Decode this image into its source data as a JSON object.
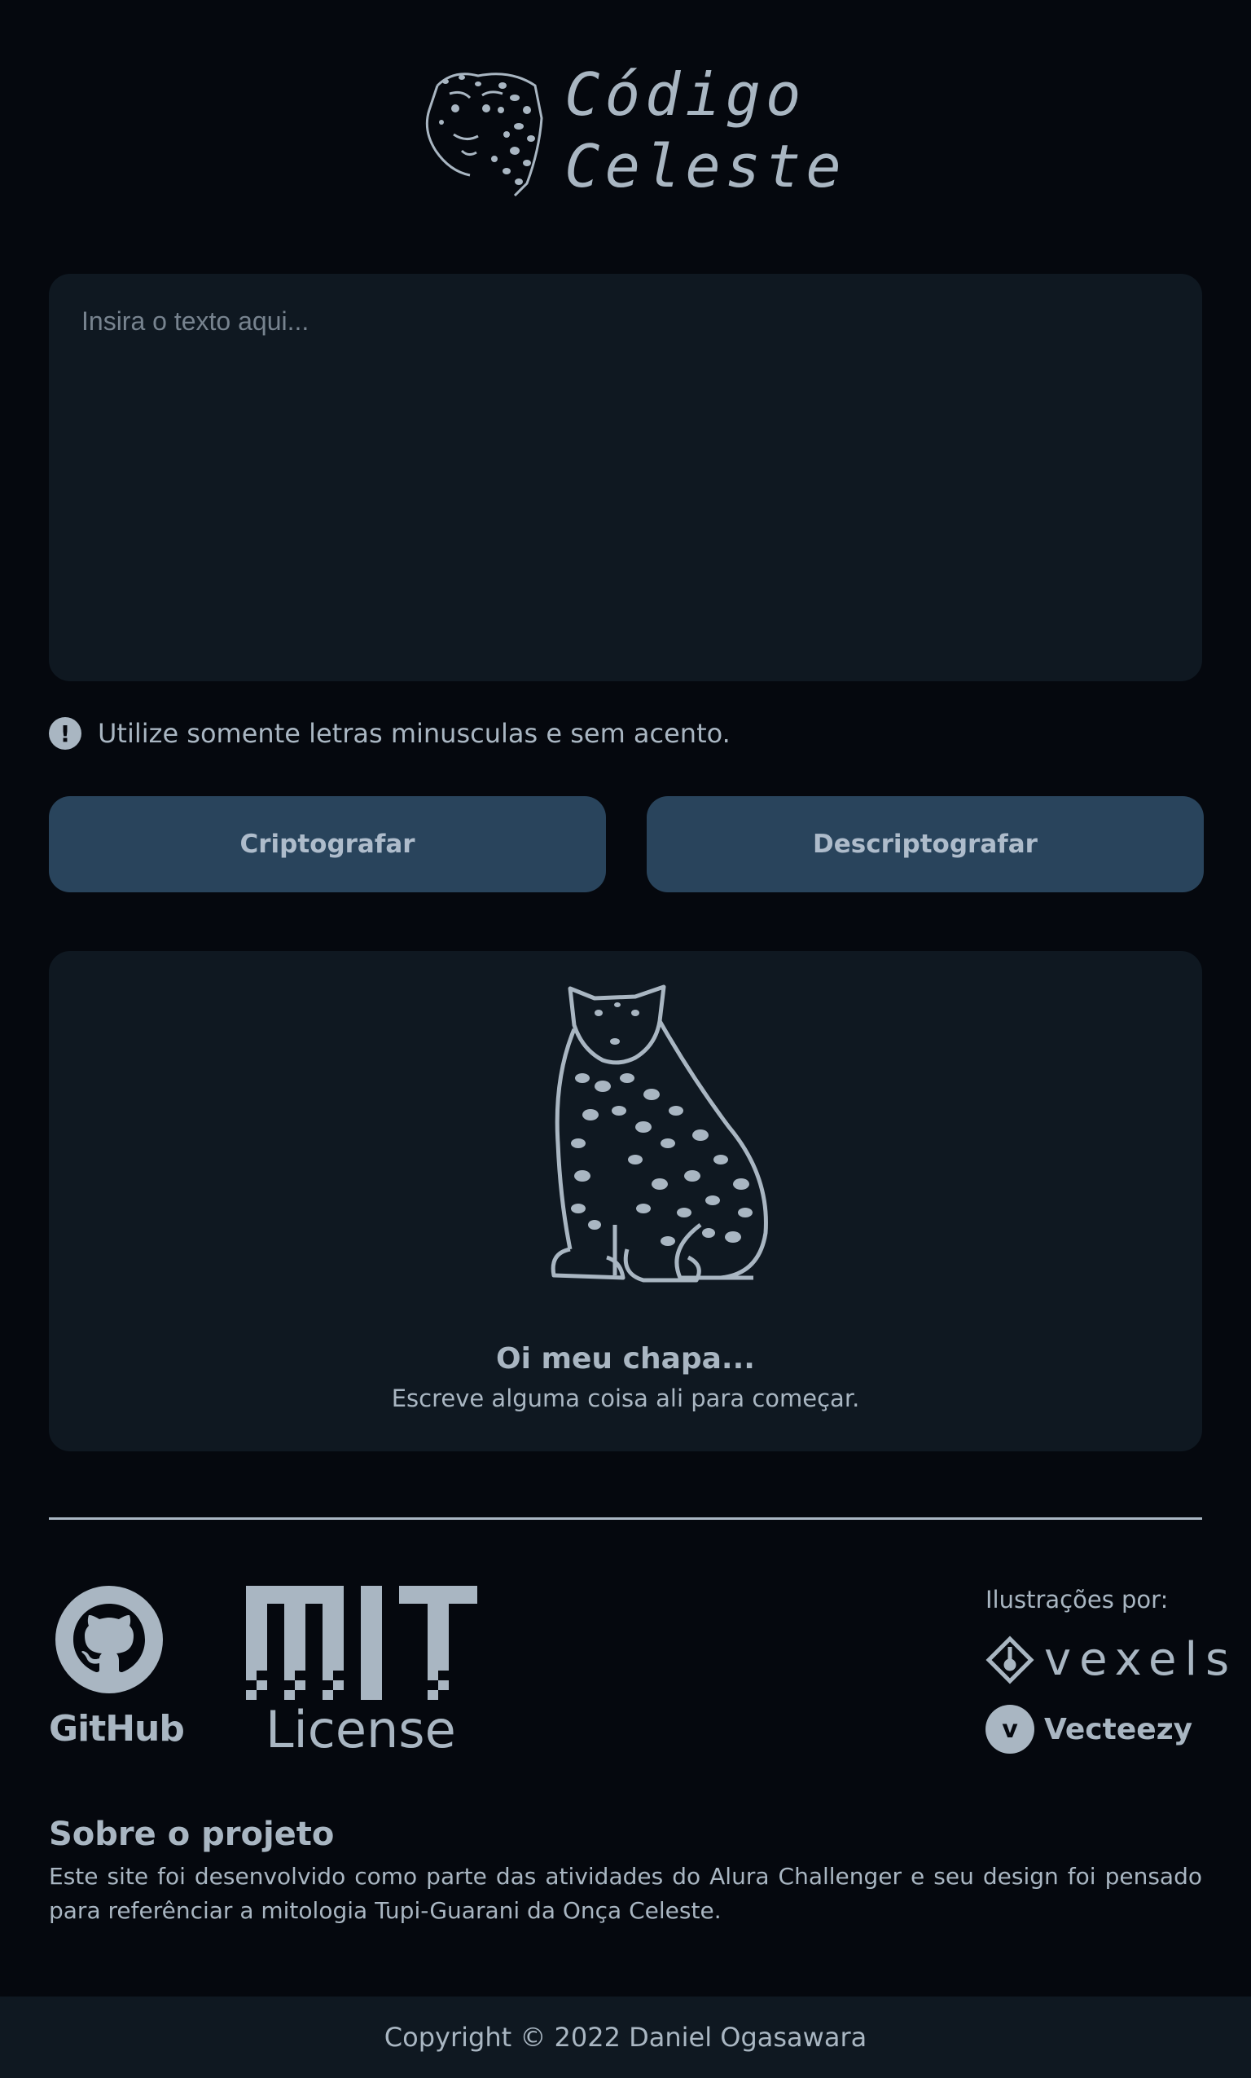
{
  "header": {
    "logo_line1": "Código",
    "logo_line2": "Celeste"
  },
  "input": {
    "placeholder": "Insira o texto aqui...",
    "value": ""
  },
  "hint": {
    "icon": "!",
    "text": "Utilize somente letras minusculas e sem acento."
  },
  "buttons": {
    "encrypt_label": "Criptografar",
    "decrypt_label": "Descriptografar"
  },
  "output": {
    "title": "Oi meu chapa...",
    "subtitle": "Escreve alguma coisa ali para começar."
  },
  "footer": {
    "github_label": "GitHub",
    "mit_label": "License",
    "credits_label": "Ilustrações por:",
    "vexels_label": "vexels",
    "vecteezy_label": "Vecteezy",
    "vecteezy_badge": "v"
  },
  "about": {
    "title": "Sobre o projeto",
    "text": "Este site foi desenvolvido como parte das atividades do Alura Challenger e seu design foi pensado para referênciar a mitologia Tupi-Guarani da Onça Celeste."
  },
  "copyright": "Copyright © 2022 Daniel Ogasawara",
  "colors": {
    "background": "#05080e",
    "panel": "#0f1821",
    "button": "#29445c",
    "text": "#a9b6c2"
  }
}
